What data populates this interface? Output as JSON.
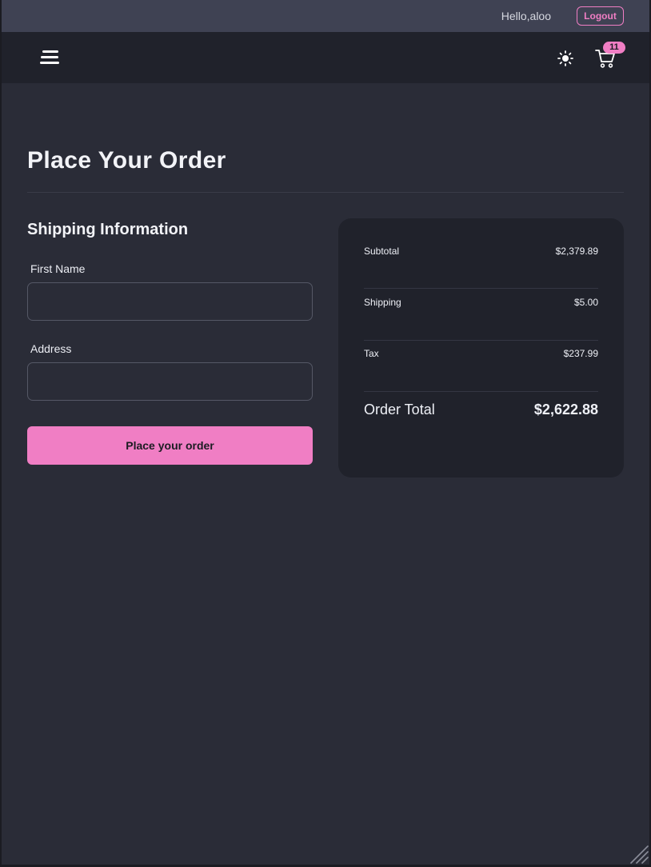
{
  "header": {
    "greeting": "Hello,aloo",
    "logout_label": "Logout"
  },
  "navbar": {
    "menu_icon": "hamburger-menu-icon",
    "theme_icon": "sun-icon",
    "cart_icon": "shopping-cart-icon",
    "cart_count": "11"
  },
  "page": {
    "title": "Place Your Order"
  },
  "shipping": {
    "title": "Shipping Information",
    "first_name_label": "First Name",
    "first_name_value": "",
    "address_label": "Address",
    "address_value": "",
    "submit_label": "Place your order"
  },
  "summary": {
    "subtotal_label": "Subtotal",
    "subtotal_value": "$2,379.89",
    "shipping_label": "Shipping",
    "shipping_value": "$5.00",
    "tax_label": "Tax",
    "tax_value": "$237.99",
    "total_label": "Order Total",
    "total_value": "$2,622.88"
  },
  "colors": {
    "accent": "#f07ec4",
    "background": "#2a2c37",
    "navbar": "#20222b",
    "topbar": "#3f4253"
  }
}
